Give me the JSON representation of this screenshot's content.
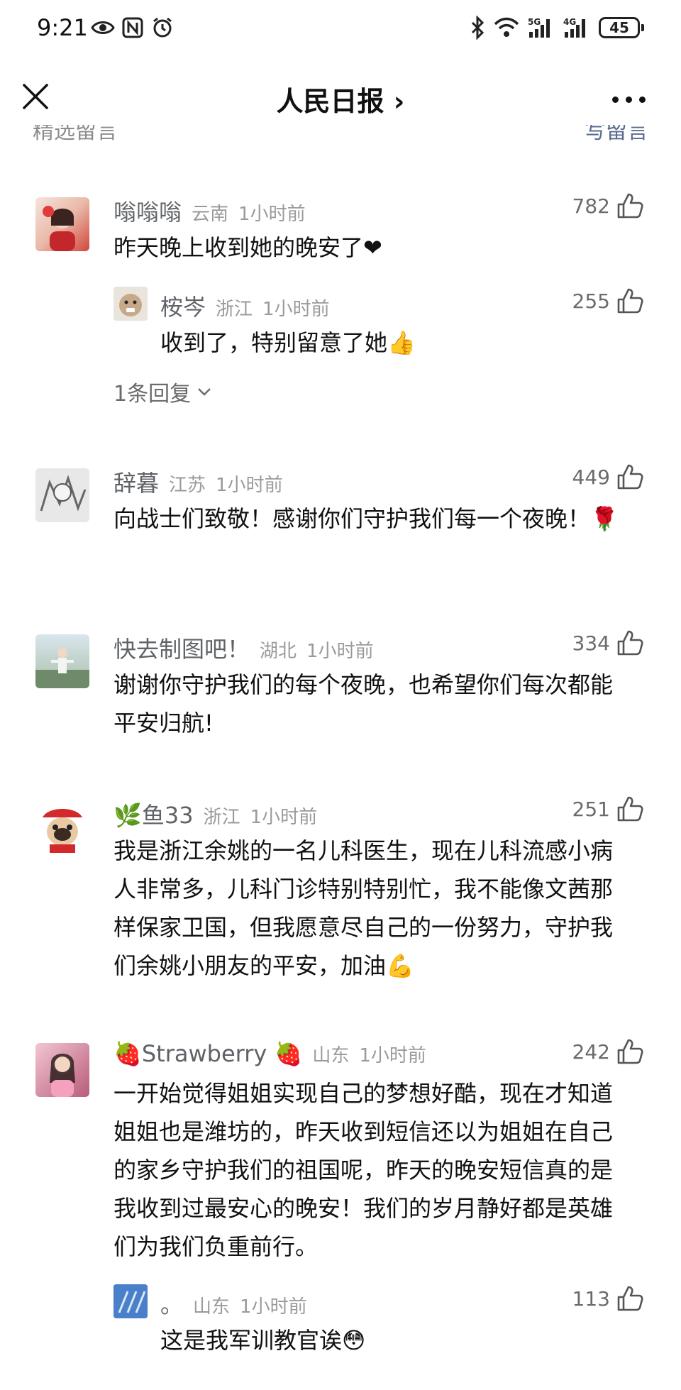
{
  "status_bar": {
    "time": "9:21",
    "battery": "45",
    "left_icons": [
      "eye-icon",
      "nfc-icon",
      "alarm-icon"
    ],
    "right_icons": [
      "bluetooth-icon",
      "wifi-icon",
      "signal-5g-icon",
      "signal-4g-icon",
      "battery-icon"
    ]
  },
  "nav": {
    "title": "人民日报 ›",
    "close_icon": "close-icon",
    "more_icon": "more-icon"
  },
  "section": {
    "left": "精选留言",
    "right": "写留言"
  },
  "comments": [
    {
      "user": "嗡嗡嗡",
      "region": "云南",
      "time": "1小时前",
      "likes": "782",
      "text": "昨天晚上收到她的晚安了❤",
      "reply": {
        "user": "桉岑",
        "region": "浙江",
        "time": "1小时前",
        "likes": "255",
        "text": "收到了，特别留意了她👍"
      },
      "more_replies": "1条回复"
    },
    {
      "user": "辞暮",
      "region": "江苏",
      "time": "1小时前",
      "likes": "449",
      "text": "向战士们致敬！感谢你们守护我们每一个夜晚！🌹"
    },
    {
      "user": "快去制图吧！",
      "region": "湖北",
      "time": "1小时前",
      "likes": "334",
      "text": "谢谢你守护我们的每个夜晚，也希望你们每次都能平安归航!"
    },
    {
      "user": "🌿鱼33",
      "region": "浙江",
      "time": "1小时前",
      "likes": "251",
      "text": "我是浙江余姚的一名儿科医生，现在儿科流感小病人非常多，儿科门诊特别特别忙，我不能像文茜那样保家卫国，但我愿意尽自己的一份努力，守护我们余姚小朋友的平安，加油💪"
    },
    {
      "user": "🍓Strawberry 🍓",
      "region": "山东",
      "time": "1小时前",
      "likes": "242",
      "text": "一开始觉得姐姐实现自己的梦想好酷，现在才知道姐姐也是潍坊的，昨天收到短信还以为姐姐在自己的家乡守护我们的祖国呢，昨天的晚安短信真的是我收到过最安心的晚安！我们的岁月静好都是英雄们为我们负重前行。",
      "reply": {
        "user": "。",
        "region": "山东",
        "time": "1小时前",
        "likes": "113",
        "text": "这是我军训教官诶😳"
      }
    }
  ],
  "colors": {
    "username": "#5f6368",
    "meta": "#9a9a9a",
    "text": "#111111",
    "link": "#5b6b8f"
  }
}
